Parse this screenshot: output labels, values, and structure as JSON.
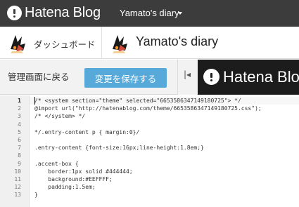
{
  "topbar": {
    "brand": "Hatena Blog",
    "blog_name": "Yamato's diary"
  },
  "header": {
    "dashboard_label": "ダッシュボード",
    "blog_title": "Yamato's diary"
  },
  "toolbar": {
    "back_label": "管理画面に戻る",
    "save_label": "変更を保存する",
    "collapse_label": "|◂"
  },
  "preview": {
    "brand": "Hatena Blog"
  },
  "editor": {
    "lines": [
      {
        "n": "1",
        "text": "/* <system section=\"theme\" selected=\"6653586347149180725\"> */"
      },
      {
        "n": "2",
        "text": "@import url(\"http://hatenablog.com/theme/6653586347149180725.css\");"
      },
      {
        "n": "3",
        "text": "/* </system> */"
      },
      {
        "n": "4",
        "text": ""
      },
      {
        "n": "5",
        "text": "*/.entry-content p { margin:0}/"
      },
      {
        "n": "6",
        "text": ""
      },
      {
        "n": "7",
        "text": ".entry-content {font-size:16px;line-height:1.8em;}"
      },
      {
        "n": "8",
        "text": ""
      },
      {
        "n": "9",
        "text": ".accent-box {"
      },
      {
        "n": "10",
        "text": "    border:1px solid #444444;"
      },
      {
        "n": "11",
        "text": "    background:#EEFFFF;"
      },
      {
        "n": "12",
        "text": "    padding:1.5em;"
      },
      {
        "n": "13",
        "text": "}"
      }
    ]
  },
  "colors": {
    "topbar": "#3c3c3c",
    "save_button": "#56a9d9",
    "preview": "#1c1c1c"
  },
  "icons": [
    "hatena-logo-icon",
    "caret-down-icon",
    "avatar-icon",
    "collapse-icon"
  ]
}
